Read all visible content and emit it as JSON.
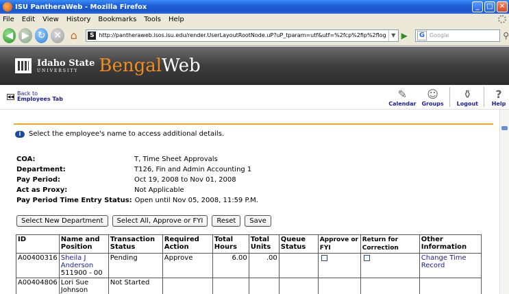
{
  "window": {
    "title": "ISU PantheraWeb - Mozilla Firefox"
  },
  "menu": [
    "File",
    "Edit",
    "View",
    "History",
    "Bookmarks",
    "Tools",
    "Help"
  ],
  "address": {
    "url": "http://pantheraweb.isos.isu.edu/render.UserLayoutRootNode.uP?uP_tparam=utf&utf=%2fcp%2fip%2flog",
    "favicon_letter": "S"
  },
  "search": {
    "engine_letter": "G",
    "placeholder": "Google"
  },
  "banner": {
    "university_main": "Idaho State",
    "university_sub": "UNIVERSITY",
    "brand_first": "Bengal",
    "brand_second": "Web"
  },
  "subnav": {
    "back_line1": "Back to",
    "back_line2": "Employees Tab",
    "icons": [
      {
        "label": "Calendar",
        "icon": "calendar-icon"
      },
      {
        "label": "Groups",
        "icon": "groups-icon"
      },
      {
        "label": "Logout",
        "icon": "logout-icon"
      },
      {
        "label": "Help",
        "icon": "help-icon"
      }
    ]
  },
  "info_message": "Select the employee's name to access additional details.",
  "details": {
    "coa_label": "COA:",
    "coa_value": "T, Time Sheet Approvals",
    "dept_label": "Department:",
    "dept_value": "T126, Fin and Admin Accounting 1",
    "period_label": "Pay Period:",
    "period_value": "Oct 19, 2008 to Nov 01, 2008",
    "proxy_label": "Act as Proxy:",
    "proxy_value": "Not Applicable",
    "status_label": "Pay Period Time Entry Status:",
    "status_value": "Open until Nov 05, 2008, 11:59 P.M."
  },
  "buttons": {
    "select_dept": "Select New Department",
    "select_all": "Select All, Approve or FYI",
    "reset": "Reset",
    "save": "Save"
  },
  "table": {
    "headers": {
      "id": "ID",
      "name": "Name and Position",
      "status": "Transaction Status",
      "action": "Required Action",
      "hours": "Total Hours",
      "units": "Total Units",
      "queue": "Queue Status",
      "approve": "Approve or FYI",
      "return": "Return for Correction",
      "other": "Other Information"
    },
    "rows": [
      {
        "id": "A00400316",
        "name": "Sheila J Anderson",
        "position": "511900 - 00",
        "status": "Pending",
        "action": "Approve",
        "hours": "6.00",
        "units": ".00",
        "queue": "",
        "other": "Change Time Record"
      },
      {
        "id": "A00404806",
        "name": "Lori Sue Johnson",
        "position": "",
        "status": "Not Started",
        "action": "",
        "hours": "",
        "units": "",
        "queue": "",
        "other": ""
      }
    ]
  }
}
